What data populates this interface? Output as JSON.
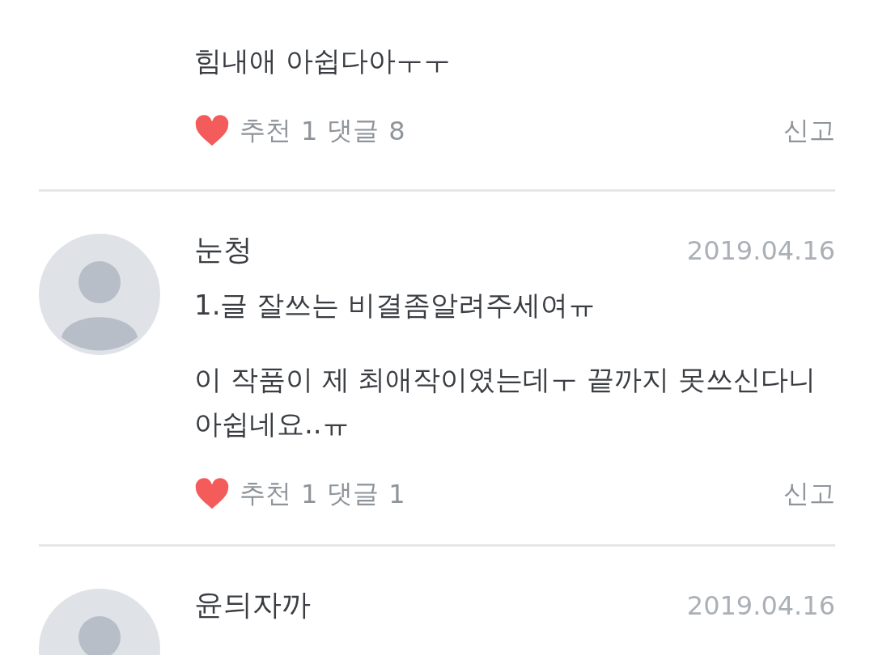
{
  "comments": [
    {
      "has_avatar": false,
      "paragraphs": [
        [
          "힘내애 아쉽다아ㅜㅜ"
        ]
      ],
      "likes_label": "추천",
      "likes": "1",
      "replies_label": "댓글",
      "replies": "8",
      "report": "신고"
    },
    {
      "has_avatar": true,
      "name": "눈청",
      "date": "2019.04.16",
      "paragraphs": [
        [
          "1.글 잘쓰는 비결좀알려주세여ㅠ"
        ],
        [
          "이 작품이 제 최애작이였는데ㅜ 끝까지 못쓰신다니",
          "아쉽네요..ㅠ"
        ]
      ],
      "likes_label": "추천",
      "likes": "1",
      "replies_label": "댓글",
      "replies": "1",
      "report": "신고"
    },
    {
      "has_avatar": true,
      "name": "윤듸자까",
      "date": "2019.04.16"
    }
  ]
}
